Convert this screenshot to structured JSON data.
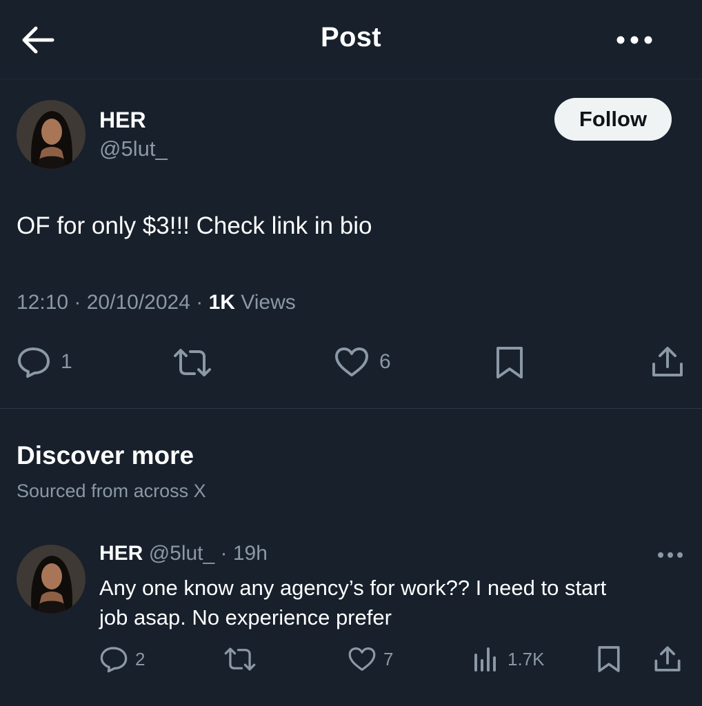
{
  "header": {
    "title": "Post"
  },
  "post": {
    "author_name": "HER",
    "author_handle": "@5lut_",
    "follow_label": "Follow",
    "text": "OF for only $3!!! Check link in bio",
    "time": "12:10",
    "date": "20/10/2024",
    "views_count": "1K",
    "views_label": "Views",
    "replies": "1",
    "likes": "6"
  },
  "discover": {
    "title": "Discover more",
    "subtitle": "Sourced from across X"
  },
  "tweet2": {
    "author_name": "HER",
    "author_handle": "@5lut_",
    "age": "19h",
    "line1": "Any one know any agency’s for work?? I need to start",
    "line2": "job asap. No experience prefer",
    "replies": "2",
    "likes": "7",
    "views": "1.7K"
  },
  "icons": {
    "back": "arrow-left-icon",
    "more": "more-horizontal-icon",
    "reply": "speech-bubble-icon",
    "retweet": "retweet-icon",
    "like": "heart-icon",
    "bookmark": "bookmark-icon",
    "share": "share-icon",
    "views": "bar-chart-icon"
  },
  "colors": {
    "background": "#17202b",
    "text": "#e7e9ea",
    "muted": "#8b98a5",
    "follow_bg": "#eff3f4"
  }
}
